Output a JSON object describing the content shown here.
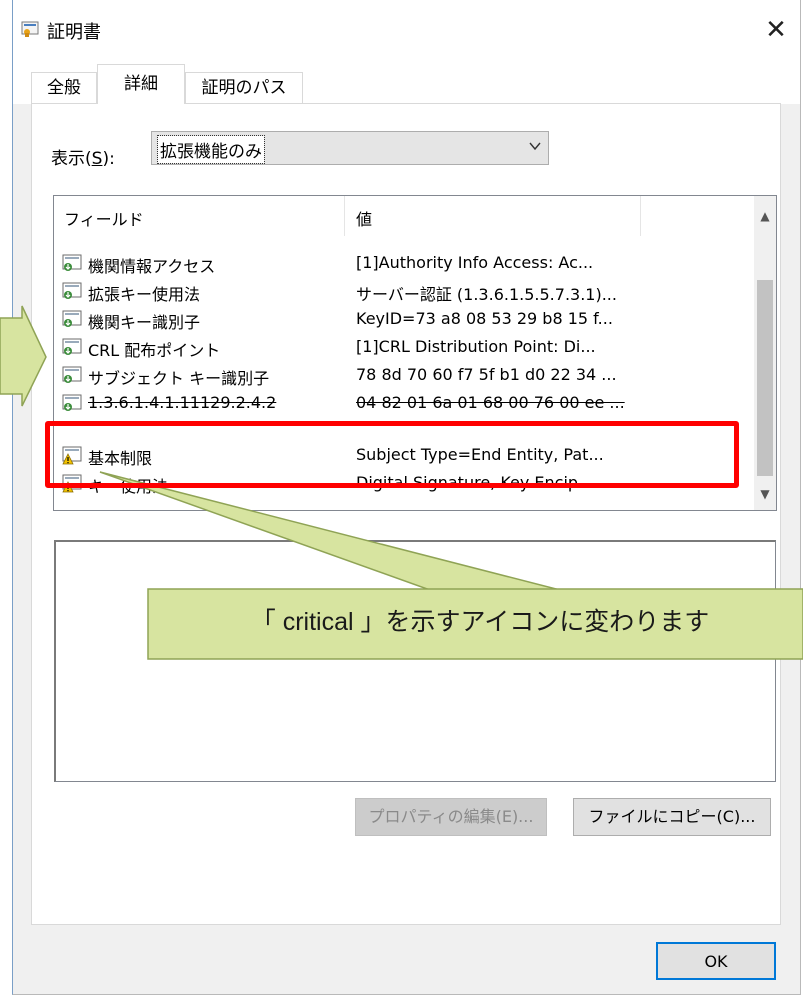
{
  "window": {
    "title": "証明書",
    "close_glyph": "✕"
  },
  "tabs": [
    {
      "label": "全般",
      "active": false
    },
    {
      "label": "詳細",
      "active": true
    },
    {
      "label": "証明のパス",
      "active": false
    }
  ],
  "show": {
    "label_prefix": "表示(",
    "label_key": "S",
    "label_suffix": "):",
    "selected": "拡張機能のみ"
  },
  "list": {
    "columns": [
      "フィールド",
      "値"
    ],
    "rows": [
      {
        "name": "機関情報アクセス",
        "value": "[1]Authority Info Access: Ac...",
        "icon": "certificate-extension-icon"
      },
      {
        "name": "拡張キー使用法",
        "value": "サーバー認証 (1.3.6.1.5.5.7.3.1)...",
        "icon": "certificate-extension-icon"
      },
      {
        "name": "機関キー識別子",
        "value": "KeyID=73 a8 08 53 29 b8 15 f...",
        "icon": "certificate-extension-icon"
      },
      {
        "name": "CRL 配布ポイント",
        "value": "[1]CRL Distribution Point: Di...",
        "icon": "certificate-extension-icon"
      },
      {
        "name": "サブジェクト キー識別子",
        "value": "78 8d 70 60 f7 5f b1 d0 22 34 ...",
        "icon": "certificate-extension-icon"
      },
      {
        "name": "1.3.6.1.4.1.11129.2.4.2",
        "value": "04 82 01 6a 01 68 00 76 00 ee ...",
        "icon": "certificate-extension-icon"
      },
      {
        "name": "基本制限",
        "value": "Subject Type=End Entity, Pat...",
        "icon": "critical-warning-icon"
      },
      {
        "name": "キー使用法",
        "value": "Digital Signature, Key Encip...",
        "icon": "critical-warning-icon"
      }
    ]
  },
  "buttons": {
    "edit_properties": "プロパティの編集(E)...",
    "copy_to_file": "ファイルにコピー(C)...",
    "ok": "OK"
  },
  "annotation": {
    "callout_text": "「 critical 」を示すアイコンに変わります",
    "highlight_color": "#ff0000",
    "callout_color": "#d7e4a0"
  }
}
